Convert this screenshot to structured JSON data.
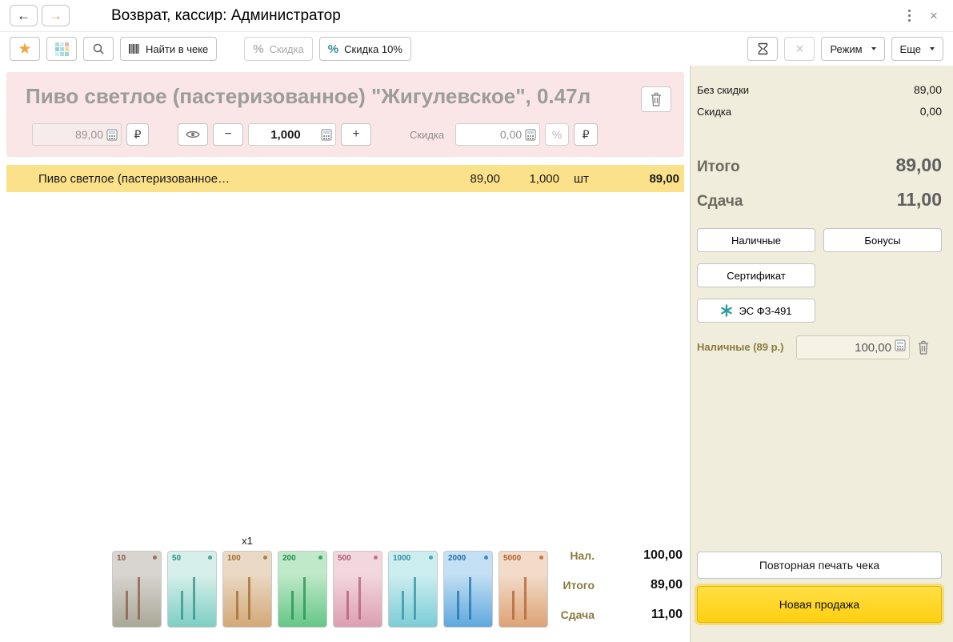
{
  "window": {
    "title": "Возврат, кассир: Администратор"
  },
  "icons": {
    "back": "←",
    "forward": "→",
    "close": "×",
    "star": "★",
    "minus": "−",
    "plus": "+",
    "percent": "%",
    "ruble": "₽"
  },
  "toolbar": {
    "find_in_receipt_label": "Найти в чеке",
    "discount_label": "Скидка",
    "discount10_label": "Скидка 10%",
    "mode_label": "Режим",
    "more_label": "Еще"
  },
  "product_panel": {
    "name": "Пиво светлое (пастеризованное) \"Жигулевское\", 0.47л",
    "price": "89,00",
    "quantity": "1,000",
    "discount_label": "Скидка",
    "discount_value": "0,00"
  },
  "receipt": {
    "rows": [
      {
        "name": "Пиво светлое (пастеризованное…",
        "price": "89,00",
        "qty": "1,000",
        "unit": "шт",
        "sum": "89,00"
      }
    ]
  },
  "cash_panel": {
    "multiplier": "x1",
    "notes": [
      {
        "value": "10",
        "light": "#d8d4cf",
        "main": "#a9a998",
        "dark": "#8a5a44"
      },
      {
        "value": "50",
        "light": "#d6efeb",
        "main": "#7ecec3",
        "dark": "#2f8f85"
      },
      {
        "value": "100",
        "light": "#ead9c4",
        "main": "#d3a878",
        "dark": "#a06a2f"
      },
      {
        "value": "200",
        "light": "#bfe9c8",
        "main": "#66c687",
        "dark": "#1f8f4d"
      },
      {
        "value": "500",
        "light": "#f2d7de",
        "main": "#dc9fb2",
        "dark": "#b25a77"
      },
      {
        "value": "1000",
        "light": "#cdeef0",
        "main": "#7cccd6",
        "dark": "#2f8fa0"
      },
      {
        "value": "2000",
        "light": "#c3e0f4",
        "main": "#5fa8dd",
        "dark": "#2270ad"
      },
      {
        "value": "5000",
        "light": "#f2dcc9",
        "main": "#dda276",
        "dark": "#b0602a"
      }
    ],
    "summary": [
      {
        "label": "Нал.",
        "value": "100,00"
      },
      {
        "label": "Итого",
        "value": "89,00"
      },
      {
        "label": "Сдача",
        "value": "11,00"
      }
    ]
  },
  "sidebar": {
    "no_discount_label": "Без скидки",
    "no_discount_value": "89,00",
    "discount_label": "Скидка",
    "discount_value": "0,00",
    "total_label": "Итого",
    "total_value": "89,00",
    "change_label": "Сдача",
    "change_value": "11,00",
    "pay_cash_label": "Наличные",
    "pay_bonus_label": "Бонусы",
    "pay_cert_label": "Сертификат",
    "pay_es_label": "ЭС ФЗ-491",
    "cash_given_label": "Наличные (89 р.)",
    "cash_given_value": "100,00",
    "reprint_label": "Повторная печать чека",
    "new_sale_label": "Новая продажа"
  }
}
